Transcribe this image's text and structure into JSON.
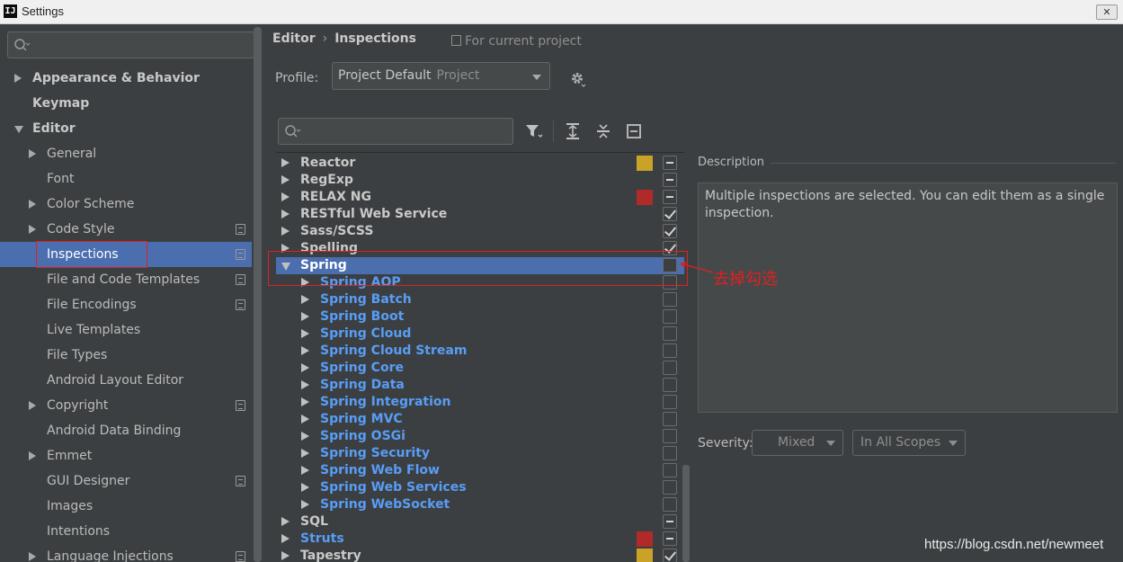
{
  "window": {
    "title": "Settings",
    "app_icon": "IJ",
    "close": "✕"
  },
  "sidebar": {
    "items": [
      {
        "label": "Appearance & Behavior",
        "indent": 0,
        "arrow": "right",
        "bold": true,
        "project": false
      },
      {
        "label": "Keymap",
        "indent": 0,
        "arrow": "none",
        "bold": true,
        "project": false
      },
      {
        "label": "Editor",
        "indent": 0,
        "arrow": "down",
        "bold": true,
        "project": false
      },
      {
        "label": "General",
        "indent": 1,
        "arrow": "right",
        "bold": false,
        "project": false
      },
      {
        "label": "Font",
        "indent": 1,
        "arrow": "none",
        "bold": false,
        "project": false
      },
      {
        "label": "Color Scheme",
        "indent": 1,
        "arrow": "right",
        "bold": false,
        "project": false
      },
      {
        "label": "Code Style",
        "indent": 1,
        "arrow": "right",
        "bold": false,
        "project": true
      },
      {
        "label": "Inspections",
        "indent": 1,
        "arrow": "none",
        "bold": false,
        "project": true,
        "selected": true
      },
      {
        "label": "File and Code Templates",
        "indent": 1,
        "arrow": "none",
        "bold": false,
        "project": true
      },
      {
        "label": "File Encodings",
        "indent": 1,
        "arrow": "none",
        "bold": false,
        "project": true
      },
      {
        "label": "Live Templates",
        "indent": 1,
        "arrow": "none",
        "bold": false,
        "project": false
      },
      {
        "label": "File Types",
        "indent": 1,
        "arrow": "none",
        "bold": false,
        "project": false
      },
      {
        "label": "Android Layout Editor",
        "indent": 1,
        "arrow": "none",
        "bold": false,
        "project": false
      },
      {
        "label": "Copyright",
        "indent": 1,
        "arrow": "right",
        "bold": false,
        "project": true
      },
      {
        "label": "Android Data Binding",
        "indent": 1,
        "arrow": "none",
        "bold": false,
        "project": false
      },
      {
        "label": "Emmet",
        "indent": 1,
        "arrow": "right",
        "bold": false,
        "project": false
      },
      {
        "label": "GUI Designer",
        "indent": 1,
        "arrow": "none",
        "bold": false,
        "project": true
      },
      {
        "label": "Images",
        "indent": 1,
        "arrow": "none",
        "bold": false,
        "project": false
      },
      {
        "label": "Intentions",
        "indent": 1,
        "arrow": "none",
        "bold": false,
        "project": false
      },
      {
        "label": "Language Injections",
        "indent": 1,
        "arrow": "right",
        "bold": false,
        "project": true
      }
    ]
  },
  "header": {
    "breadcrumb": [
      "Editor",
      "Inspections"
    ],
    "breadcrumb_sep": "›",
    "for_project": "For current project"
  },
  "profile": {
    "label": "Profile:",
    "value": "Project Default",
    "sub": "Project"
  },
  "tree": {
    "rows": [
      {
        "label": "Reactor",
        "level": 0,
        "arrow": "right",
        "swatch": "#c9a227",
        "check": "mixed"
      },
      {
        "label": "RegExp",
        "level": 0,
        "arrow": "right",
        "swatch": "",
        "check": "mixed"
      },
      {
        "label": "RELAX NG",
        "level": 0,
        "arrow": "right",
        "swatch": "#b02a2a",
        "check": "mixed"
      },
      {
        "label": "RESTful Web Service",
        "level": 0,
        "arrow": "right",
        "swatch": "",
        "check": "checked"
      },
      {
        "label": "Sass/SCSS",
        "level": 0,
        "arrow": "right",
        "swatch": "",
        "check": "checked"
      },
      {
        "label": "Spelling",
        "level": 0,
        "arrow": "right",
        "swatch": "",
        "check": "checked"
      },
      {
        "label": "Spring",
        "level": 0,
        "arrow": "down",
        "swatch": "",
        "check": "unchecked",
        "selected": true
      },
      {
        "label": "Spring AOP",
        "level": 1,
        "arrow": "right",
        "swatch": "",
        "check": "unchecked"
      },
      {
        "label": "Spring Batch",
        "level": 1,
        "arrow": "right",
        "swatch": "",
        "check": "unchecked"
      },
      {
        "label": "Spring Boot",
        "level": 1,
        "arrow": "right",
        "swatch": "",
        "check": "unchecked"
      },
      {
        "label": "Spring Cloud",
        "level": 1,
        "arrow": "right",
        "swatch": "",
        "check": "unchecked"
      },
      {
        "label": "Spring Cloud Stream",
        "level": 1,
        "arrow": "right",
        "swatch": "",
        "check": "unchecked"
      },
      {
        "label": "Spring Core",
        "level": 1,
        "arrow": "right",
        "swatch": "",
        "check": "unchecked"
      },
      {
        "label": "Spring Data",
        "level": 1,
        "arrow": "right",
        "swatch": "",
        "check": "unchecked"
      },
      {
        "label": "Spring Integration",
        "level": 1,
        "arrow": "right",
        "swatch": "",
        "check": "unchecked"
      },
      {
        "label": "Spring MVC",
        "level": 1,
        "arrow": "right",
        "swatch": "",
        "check": "unchecked"
      },
      {
        "label": "Spring OSGi",
        "level": 1,
        "arrow": "right",
        "swatch": "",
        "check": "unchecked"
      },
      {
        "label": "Spring Security",
        "level": 1,
        "arrow": "right",
        "swatch": "",
        "check": "unchecked"
      },
      {
        "label": "Spring Web Flow",
        "level": 1,
        "arrow": "right",
        "swatch": "",
        "check": "unchecked"
      },
      {
        "label": "Spring Web Services",
        "level": 1,
        "arrow": "right",
        "swatch": "",
        "check": "unchecked"
      },
      {
        "label": "Spring WebSocket",
        "level": 1,
        "arrow": "right",
        "swatch": "",
        "check": "unchecked"
      },
      {
        "label": "SQL",
        "level": 0,
        "arrow": "right",
        "swatch": "",
        "check": "mixed"
      },
      {
        "label": "Struts",
        "level": 0,
        "arrow": "right",
        "swatch": "#b02a2a",
        "check": "mixed",
        "link": true
      },
      {
        "label": "Tapestry",
        "level": 0,
        "arrow": "right",
        "swatch": "#c9a227",
        "check": "checked"
      }
    ]
  },
  "description": {
    "title": "Description",
    "text": "Multiple inspections are selected. You can edit them as a single inspection."
  },
  "severity": {
    "label": "Severity:",
    "value": "Mixed",
    "scope": "In All Scopes"
  },
  "annotation": {
    "text": "去掉勾选"
  },
  "watermark": "https://blog.csdn.net/newmeet",
  "colors": {
    "selection": "#4b6eaf",
    "link": "#589df6",
    "annotation": "#e02020"
  },
  "icons": [
    "search-icon",
    "gear-icon",
    "filter-icon",
    "expand-all-icon",
    "collapse-all-icon",
    "reset-icon"
  ]
}
